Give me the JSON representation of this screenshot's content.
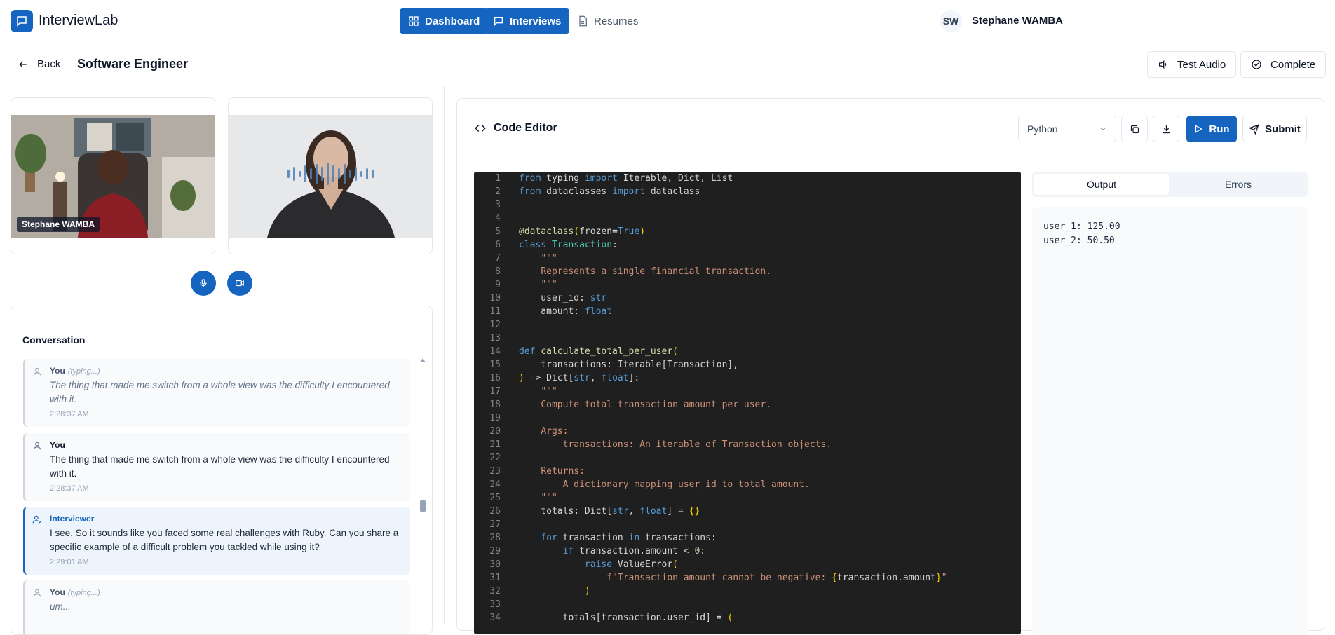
{
  "app": {
    "name": "InterviewLab"
  },
  "nav": {
    "dashboard": "Dashboard",
    "interviews": "Interviews",
    "resumes": "Resumes"
  },
  "user": {
    "initials": "SW",
    "name": "Stephane WAMBA"
  },
  "subheader": {
    "back": "Back",
    "title": "Software Engineer",
    "test_audio": "Test Audio",
    "complete": "Complete"
  },
  "video": {
    "candidate_name": "Stephane WAMBA"
  },
  "conversation": {
    "title": "Conversation",
    "messages": [
      {
        "speaker": "You",
        "status": "(typing...)",
        "text": "The thing that made me switch from a whole view was the difficulty I encountered with it.",
        "time": "2:28:37 AM"
      },
      {
        "speaker": "You",
        "status": "",
        "text": "The thing that made me switch from a whole view was the difficulty I encountered with it.",
        "time": "2:28:37 AM"
      },
      {
        "speaker": "Interviewer",
        "status": "",
        "text": "I see. So it sounds like you faced some real challenges with Ruby. Can you share a specific example of a difficult problem you tackled while using it?",
        "time": "2:29:01 AM"
      },
      {
        "speaker": "You",
        "status": "(typing...)",
        "text": "um...",
        "time": ""
      }
    ]
  },
  "editor": {
    "title": "Code Editor",
    "language": "Python",
    "run": "Run",
    "submit": "Submit",
    "code_lines": [
      "from typing import Iterable, Dict, List",
      "from dataclasses import dataclass",
      "",
      "",
      "@dataclass(frozen=True)",
      "class Transaction:",
      "    \"\"\"",
      "    Represents a single financial transaction.",
      "    \"\"\"",
      "    user_id: str",
      "    amount: float",
      "",
      "",
      "def calculate_total_per_user(",
      "    transactions: Iterable[Transaction],",
      ") -> Dict[str, float]:",
      "    \"\"\"",
      "    Compute total transaction amount per user.",
      "",
      "    Args:",
      "        transactions: An iterable of Transaction objects.",
      "",
      "    Returns:",
      "        A dictionary mapping user_id to total amount.",
      "    \"\"\"",
      "    totals: Dict[str, float] = {}",
      "",
      "    for transaction in transactions:",
      "        if transaction.amount < 0:",
      "            raise ValueError(",
      "                f\"Transaction amount cannot be negative: {transaction.amount}\"",
      "            )",
      "",
      "        totals[transaction.user_id] = ("
    ]
  },
  "output": {
    "tab_output": "Output",
    "tab_errors": "Errors",
    "lines": [
      "user_1: 125.00",
      "user_2: 50.50"
    ]
  },
  "colors": {
    "primary": "#1565c0",
    "editor_bg": "#1f1f1f"
  }
}
